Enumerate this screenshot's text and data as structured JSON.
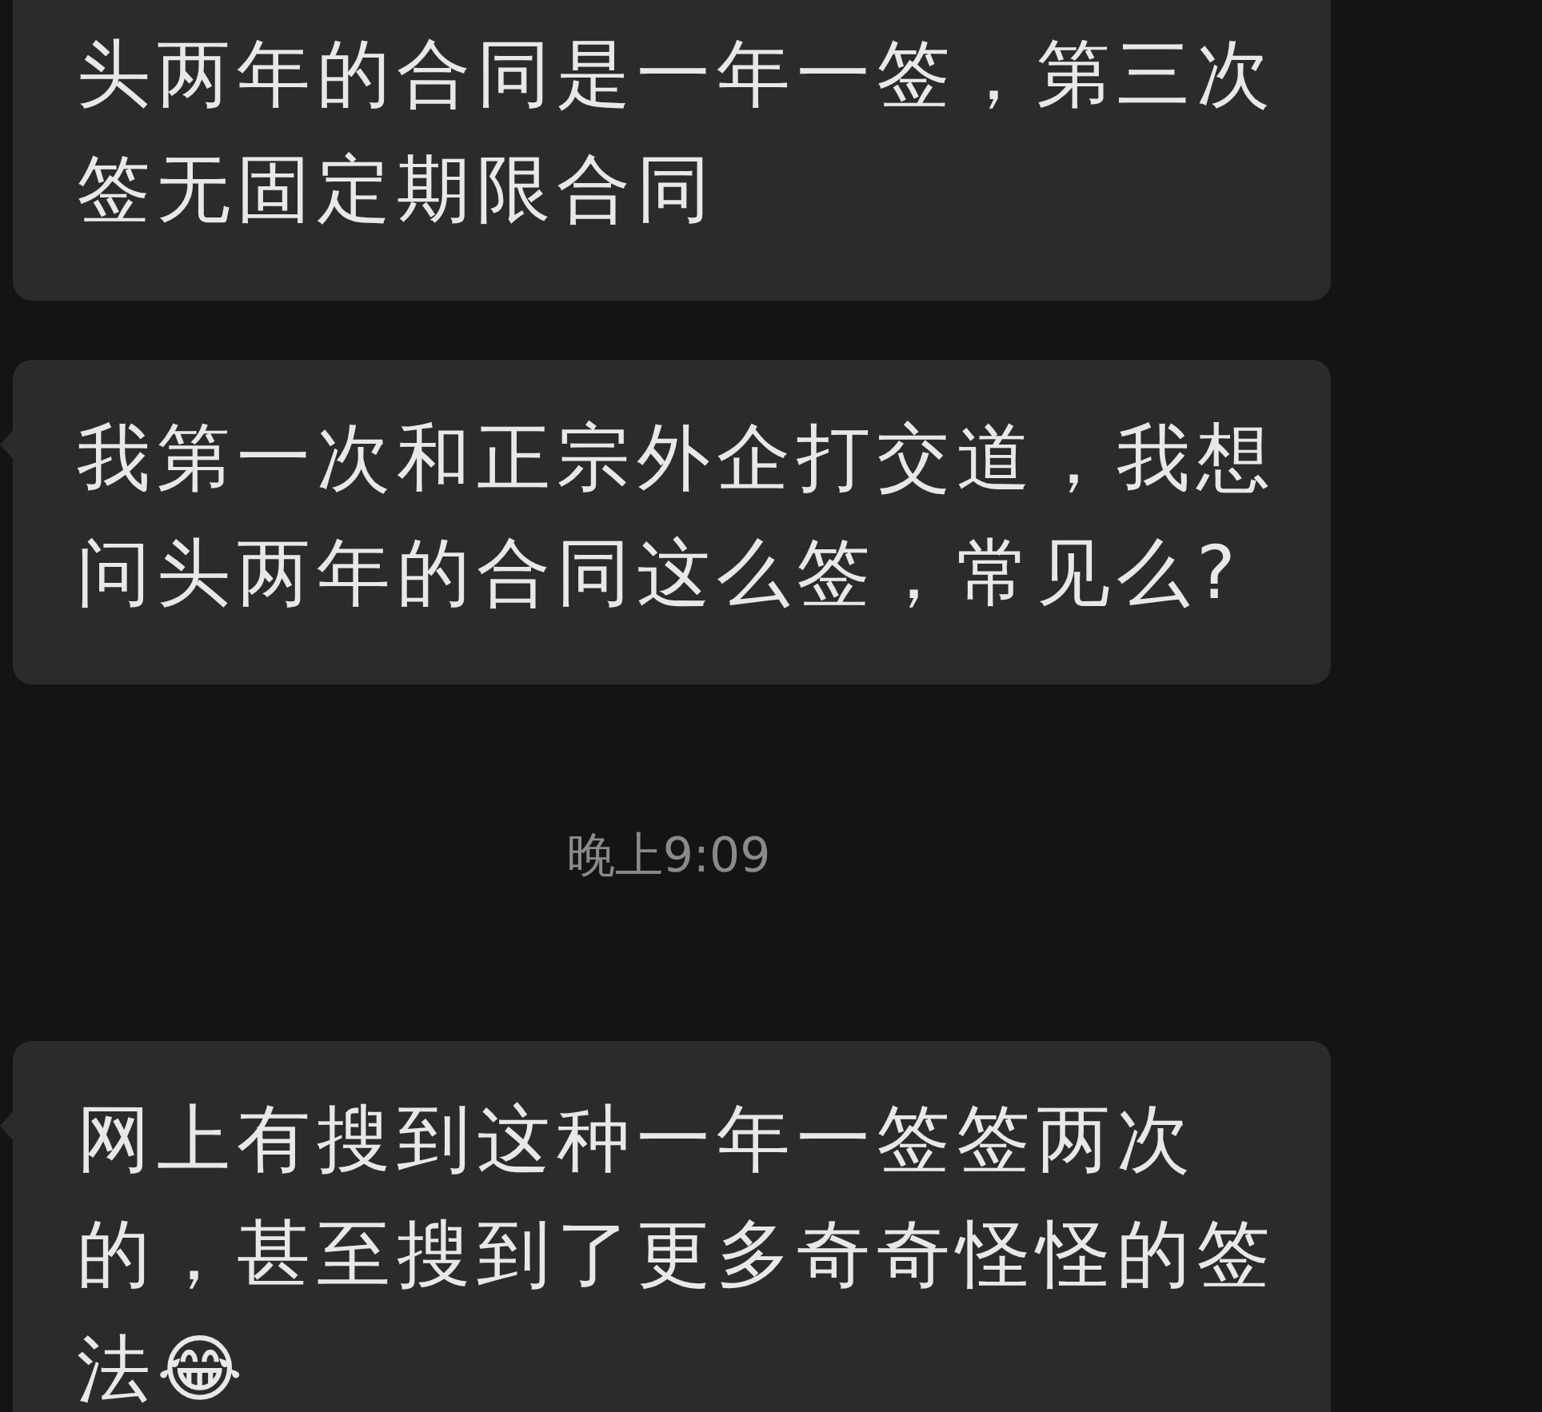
{
  "messages": [
    {
      "kind": "bubble",
      "text": "头两年的合同是一年一签，第三次签无固定期限合同",
      "tail": false
    },
    {
      "kind": "bubble",
      "text": "我第一次和正宗外企打交道，我想问头两年的合同这么签，常见么?",
      "tail": true
    },
    {
      "kind": "time",
      "text": "晚上9:09"
    },
    {
      "kind": "bubble",
      "text": "网上有搜到这种一年一签签两次的，甚至搜到了更多奇奇怪怪的签法😂",
      "tail": true
    }
  ]
}
